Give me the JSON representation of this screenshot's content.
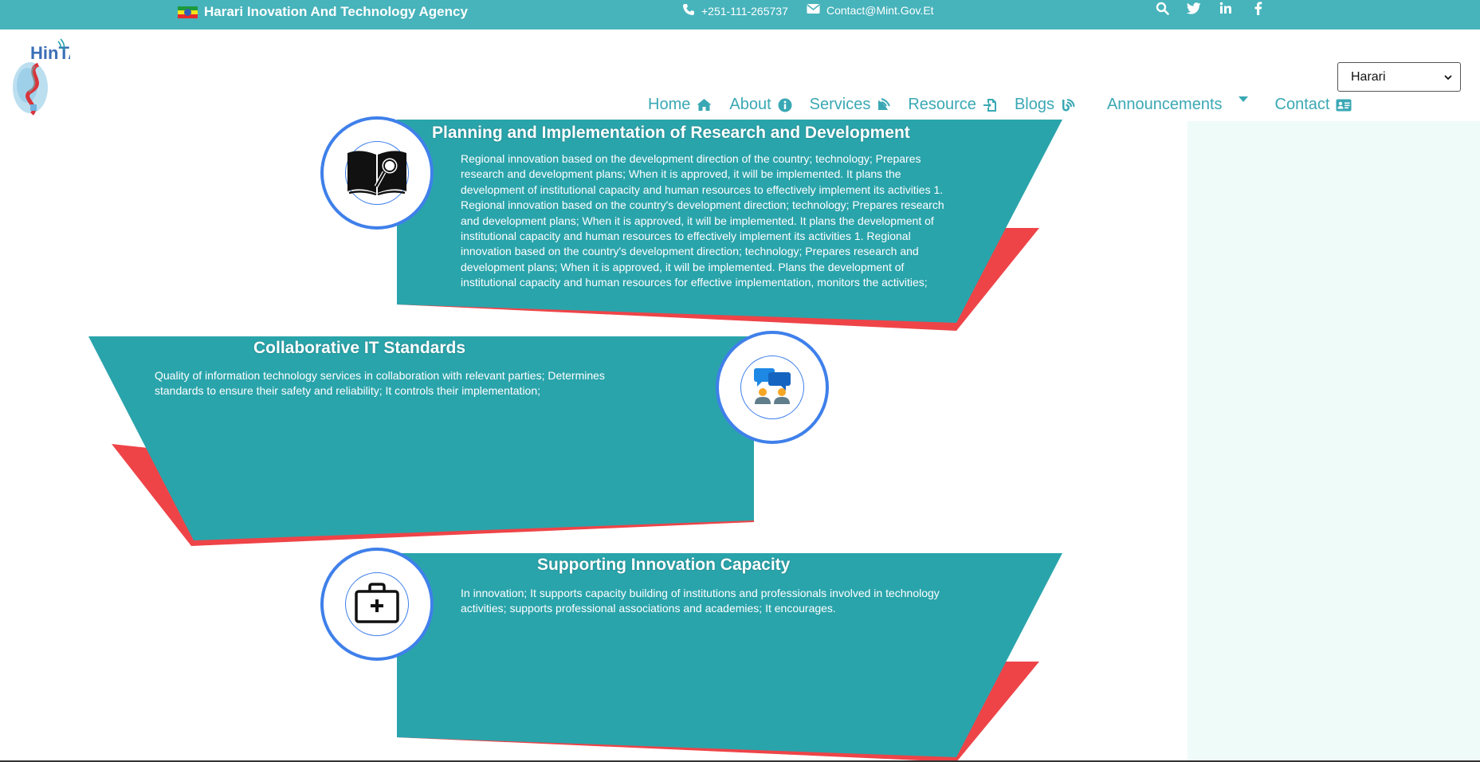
{
  "topbar": {
    "agency_name": "Harari Inovation And Technology Agency",
    "phone": "+251-111-265737",
    "email": "Contact@Mint.Gov.Et",
    "flag_colors": [
      "#1e9a3b",
      "#f6e319",
      "#e42a2a"
    ],
    "social_icons": [
      "search-icon",
      "twitter-icon",
      "linkedin-icon",
      "facebook-icon"
    ]
  },
  "header": {
    "logo_text": "HinTA",
    "nav": [
      {
        "label": "Home",
        "icon": "home-icon"
      },
      {
        "label": "About",
        "icon": "info-icon"
      },
      {
        "label": "Services",
        "icon": "satellite-dish-icon"
      },
      {
        "label": "Resource",
        "icon": "file-import-icon"
      },
      {
        "label": "Blogs",
        "icon": "blog-icon"
      },
      {
        "label": "Announcements",
        "icon": "caret-down-icon"
      },
      {
        "label": "Contact",
        "icon": "address-card-icon"
      }
    ],
    "language_select": "Harari"
  },
  "colors": {
    "teal": "#2aa4ab",
    "red": "#ee4448",
    "accent_blue": "#3f80ea",
    "topbar": "#47b3bb",
    "nav_text": "#3aa8b4"
  },
  "cards": [
    {
      "title": "Planning and Implementation of Research and Development",
      "icon": "book-search-icon",
      "text": "Regional innovation based on the development direction of the country; technology; Prepares research and development plans; When it is approved, it will be implemented. It plans the development of institutional capacity and human resources to effectively implement its activities 1. Regional innovation based on the country's development direction; technology; Prepares research and development plans; When it is approved, it will be implemented. It plans the development of institutional capacity and human resources to effectively implement its activities 1. Regional innovation based on the country's development direction; technology; Prepares research and development plans; When it is approved, it will be implemented. Plans the development of institutional capacity and human resources for effective implementation, monitors the activities;"
    },
    {
      "title": "Collaborative IT Standards",
      "icon": "collaboration-chat-icon",
      "text": "Quality of information technology services in collaboration with relevant parties; Determines standards to ensure their safety and reliability; It controls their implementation;"
    },
    {
      "title": "Supporting Innovation Capacity",
      "icon": "first-aid-kit-icon",
      "text": "In innovation; It supports capacity building of institutions and professionals involved in technology activities; supports professional associations and academies; It encourages."
    }
  ]
}
